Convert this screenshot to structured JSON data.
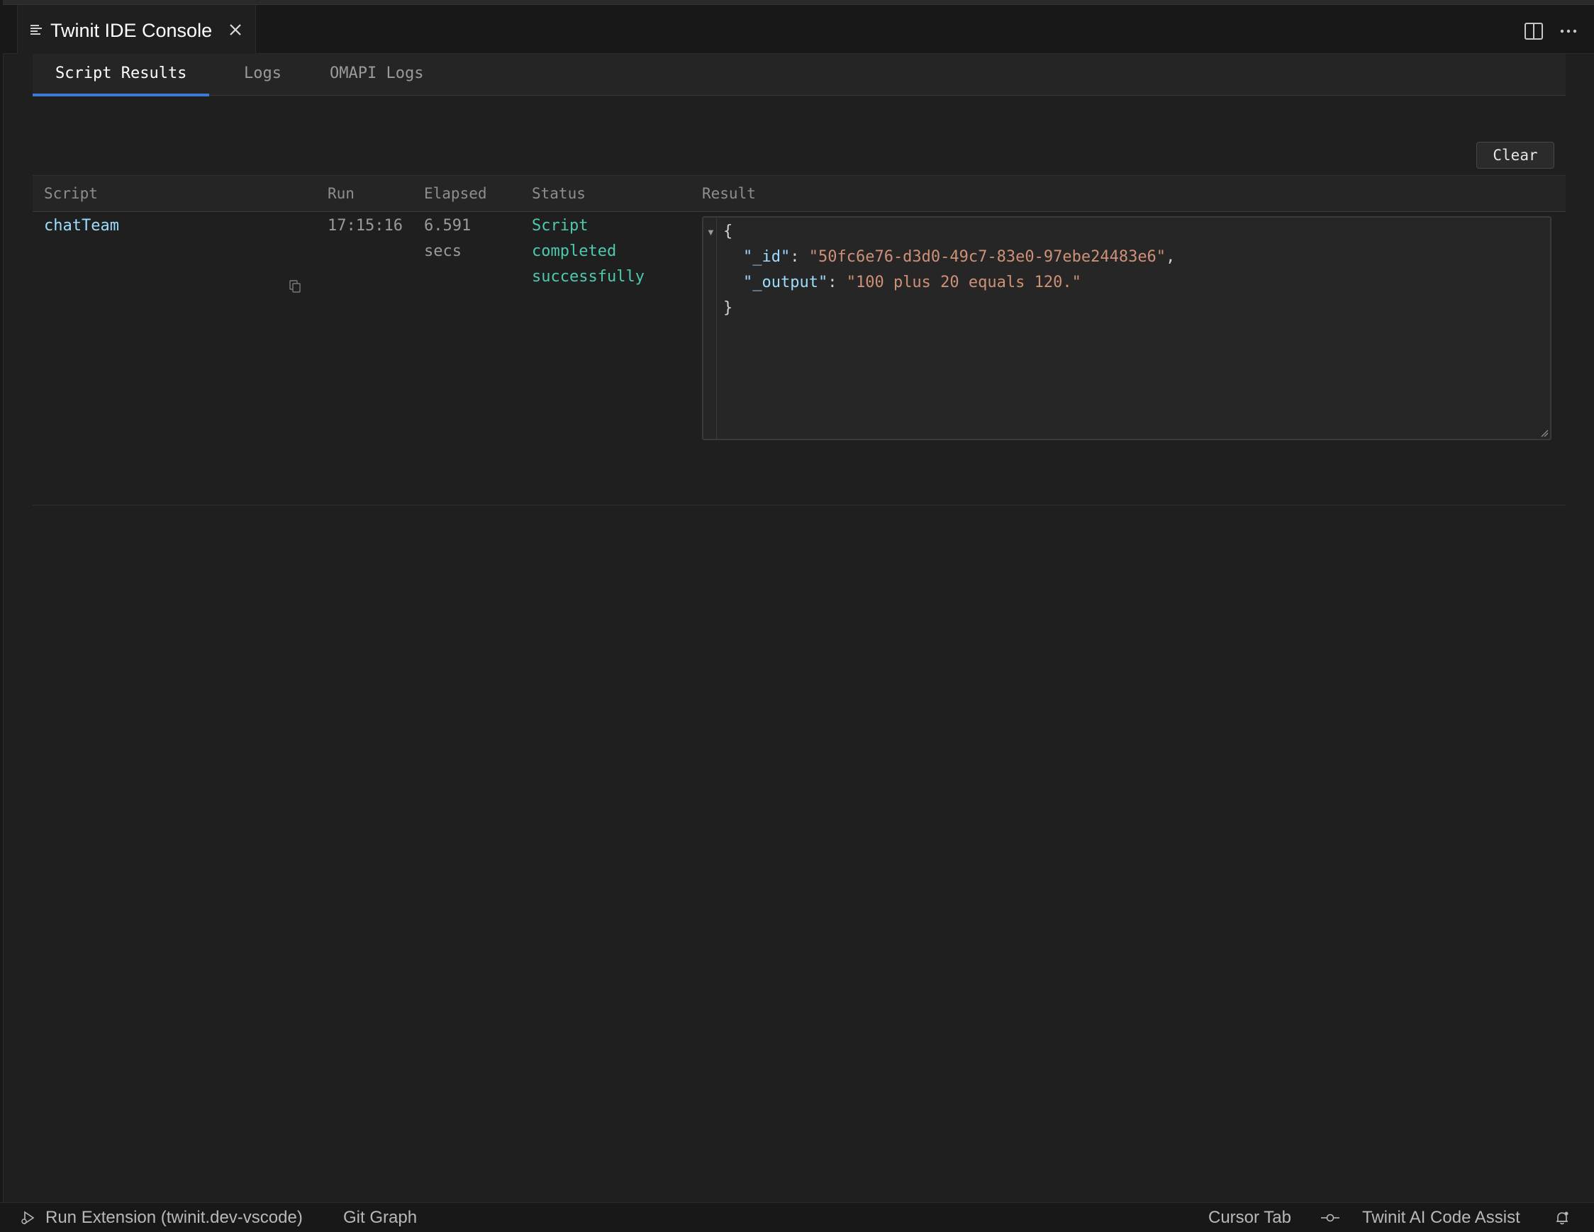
{
  "editor_tab": {
    "title": "Twinit IDE Console"
  },
  "console": {
    "subtabs": [
      {
        "label": "Script Results",
        "active": true
      },
      {
        "label": "Logs",
        "active": false
      },
      {
        "label": "OMAPI Logs",
        "active": false
      }
    ],
    "clear_label": "Clear",
    "columns": [
      "Script",
      "Run",
      "Elapsed",
      "Status",
      "Result"
    ],
    "rows": [
      {
        "script": "chatTeam",
        "run": "17:15:16",
        "elapsed": "6.591 secs",
        "status": "Script completed successfully",
        "result": {
          "open": "{",
          "id_key": "\"_id\"",
          "id_value": "\"50fc6e76-d3d0-49c7-83e0-97ebe24483e6\"",
          "output_key": "\"_output\"",
          "output_value": "\"100 plus 20 equals 120.\"",
          "close": "}"
        }
      }
    ]
  },
  "statusbar": {
    "run_extension": "Run Extension (twinit.dev-vscode)",
    "git_graph": "Git Graph",
    "cursor_tab": "Cursor Tab",
    "ai_assist": "Twinit AI Code Assist"
  },
  "colors": {
    "background": "#1f1f1f",
    "accent": "#3c7ad6",
    "script_link": "#9cdcfe",
    "status_success": "#4ec9b0",
    "json_string": "#ce9178"
  },
  "icons": [
    "list-icon",
    "close-icon",
    "split-editor-icon",
    "more-actions-icon",
    "copy-icon",
    "fold-arrow-icon",
    "resize-handle-icon",
    "debug-run-icon",
    "commit-icon",
    "bell-icon"
  ]
}
